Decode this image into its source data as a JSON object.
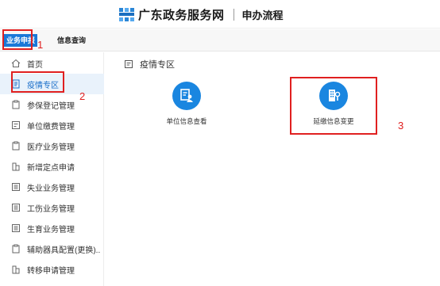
{
  "header": {
    "site_name": "广东政务服务网",
    "subtitle": "申办流程"
  },
  "topbar": {
    "tab_business": "业务申报",
    "tab_query": "信息查询"
  },
  "sidebar": {
    "items": [
      {
        "label": "首页",
        "icon": "home-icon"
      },
      {
        "label": "疫情专区",
        "icon": "document-icon"
      },
      {
        "label": "参保登记管理",
        "icon": "clipboard-icon"
      },
      {
        "label": "单位缴费管理",
        "icon": "form-icon"
      },
      {
        "label": "医疗业务管理",
        "icon": "clipboard-icon"
      },
      {
        "label": "新增定点申请",
        "icon": "building-icon"
      },
      {
        "label": "失业业务管理",
        "icon": "list-icon"
      },
      {
        "label": "工伤业务管理",
        "icon": "list-icon"
      },
      {
        "label": "生育业务管理",
        "icon": "list-icon"
      },
      {
        "label": "辅助器具配置(更换)..",
        "icon": "clipboard-icon"
      },
      {
        "label": "转移申请管理",
        "icon": "building-icon"
      }
    ]
  },
  "main": {
    "section_title": "疫情专区",
    "services": [
      {
        "label": "单位信息查看",
        "icon": "person-doc-icon"
      },
      {
        "label": "延缴信息变更",
        "icon": "building-edit-icon"
      }
    ]
  },
  "annotations": [
    "1",
    "2",
    "3"
  ],
  "colors": {
    "accent": "#1a78d8",
    "annotation": "#e02020",
    "active_bg": "#e9f2fb"
  }
}
